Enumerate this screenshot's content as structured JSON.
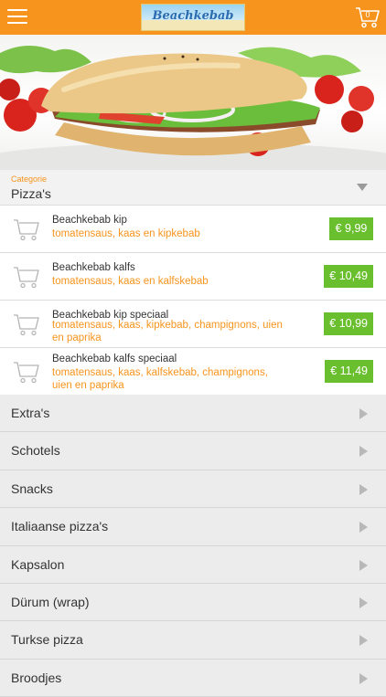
{
  "header": {
    "menu_icon": "hamburger-menu-icon",
    "logo_text": "Beachkebab",
    "cart_icon": "shopping-cart-icon",
    "cart_count": "0",
    "brand_color": "#f7941d"
  },
  "hero": {
    "image": "kebab sandwich photo"
  },
  "category_select": {
    "label": "Categorie",
    "value": "Pizza's"
  },
  "products": [
    {
      "name": "Beachkebab kip",
      "description": "tomatensaus, kaas en kipkebab",
      "price": "€ 9,99"
    },
    {
      "name": "Beachkebab kalfs",
      "description": "tomatensaus, kaas en kalfskebab",
      "price": "€ 10,49"
    },
    {
      "name": "Beachkebab kip speciaal",
      "description": "tomatensaus, kaas, kipkebab, champignons, uien en paprika",
      "price": "€ 10,99"
    },
    {
      "name": "Beachkebab kalfs speciaal",
      "description": "tomatensaus, kaas, kalfskebab, champignons, uien en paprika",
      "price": "€ 11,49"
    }
  ],
  "categories": [
    {
      "label": "Extra's"
    },
    {
      "label": "Schotels"
    },
    {
      "label": "Snacks"
    },
    {
      "label": "Italiaanse pizza's"
    },
    {
      "label": "Kapsalon"
    },
    {
      "label": "Dürum (wrap)"
    },
    {
      "label": "Turkse pizza"
    },
    {
      "label": "Broodjes"
    }
  ],
  "colors": {
    "accent": "#f7941d",
    "price": "#6abf2e"
  }
}
